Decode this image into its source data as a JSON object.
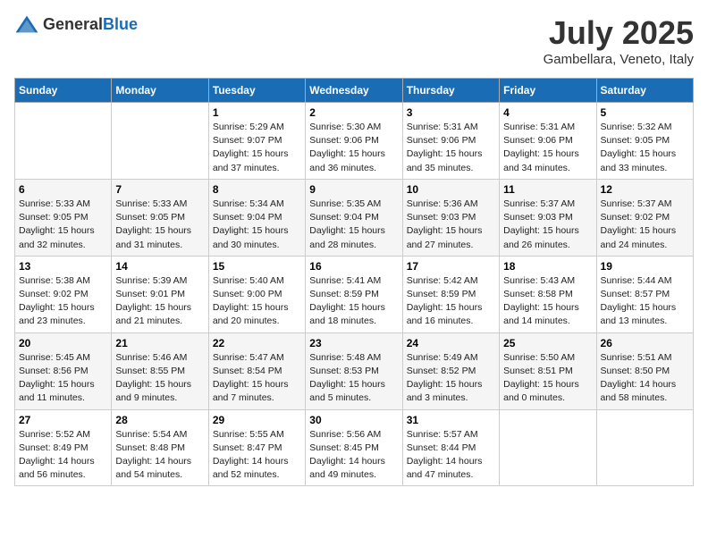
{
  "header": {
    "logo_general": "General",
    "logo_blue": "Blue",
    "month": "July 2025",
    "location": "Gambellara, Veneto, Italy"
  },
  "columns": [
    "Sunday",
    "Monday",
    "Tuesday",
    "Wednesday",
    "Thursday",
    "Friday",
    "Saturday"
  ],
  "weeks": [
    [
      {
        "day": "",
        "details": ""
      },
      {
        "day": "",
        "details": ""
      },
      {
        "day": "1",
        "details": "Sunrise: 5:29 AM\nSunset: 9:07 PM\nDaylight: 15 hours and 37 minutes."
      },
      {
        "day": "2",
        "details": "Sunrise: 5:30 AM\nSunset: 9:06 PM\nDaylight: 15 hours and 36 minutes."
      },
      {
        "day": "3",
        "details": "Sunrise: 5:31 AM\nSunset: 9:06 PM\nDaylight: 15 hours and 35 minutes."
      },
      {
        "day": "4",
        "details": "Sunrise: 5:31 AM\nSunset: 9:06 PM\nDaylight: 15 hours and 34 minutes."
      },
      {
        "day": "5",
        "details": "Sunrise: 5:32 AM\nSunset: 9:05 PM\nDaylight: 15 hours and 33 minutes."
      }
    ],
    [
      {
        "day": "6",
        "details": "Sunrise: 5:33 AM\nSunset: 9:05 PM\nDaylight: 15 hours and 32 minutes."
      },
      {
        "day": "7",
        "details": "Sunrise: 5:33 AM\nSunset: 9:05 PM\nDaylight: 15 hours and 31 minutes."
      },
      {
        "day": "8",
        "details": "Sunrise: 5:34 AM\nSunset: 9:04 PM\nDaylight: 15 hours and 30 minutes."
      },
      {
        "day": "9",
        "details": "Sunrise: 5:35 AM\nSunset: 9:04 PM\nDaylight: 15 hours and 28 minutes."
      },
      {
        "day": "10",
        "details": "Sunrise: 5:36 AM\nSunset: 9:03 PM\nDaylight: 15 hours and 27 minutes."
      },
      {
        "day": "11",
        "details": "Sunrise: 5:37 AM\nSunset: 9:03 PM\nDaylight: 15 hours and 26 minutes."
      },
      {
        "day": "12",
        "details": "Sunrise: 5:37 AM\nSunset: 9:02 PM\nDaylight: 15 hours and 24 minutes."
      }
    ],
    [
      {
        "day": "13",
        "details": "Sunrise: 5:38 AM\nSunset: 9:02 PM\nDaylight: 15 hours and 23 minutes."
      },
      {
        "day": "14",
        "details": "Sunrise: 5:39 AM\nSunset: 9:01 PM\nDaylight: 15 hours and 21 minutes."
      },
      {
        "day": "15",
        "details": "Sunrise: 5:40 AM\nSunset: 9:00 PM\nDaylight: 15 hours and 20 minutes."
      },
      {
        "day": "16",
        "details": "Sunrise: 5:41 AM\nSunset: 8:59 PM\nDaylight: 15 hours and 18 minutes."
      },
      {
        "day": "17",
        "details": "Sunrise: 5:42 AM\nSunset: 8:59 PM\nDaylight: 15 hours and 16 minutes."
      },
      {
        "day": "18",
        "details": "Sunrise: 5:43 AM\nSunset: 8:58 PM\nDaylight: 15 hours and 14 minutes."
      },
      {
        "day": "19",
        "details": "Sunrise: 5:44 AM\nSunset: 8:57 PM\nDaylight: 15 hours and 13 minutes."
      }
    ],
    [
      {
        "day": "20",
        "details": "Sunrise: 5:45 AM\nSunset: 8:56 PM\nDaylight: 15 hours and 11 minutes."
      },
      {
        "day": "21",
        "details": "Sunrise: 5:46 AM\nSunset: 8:55 PM\nDaylight: 15 hours and 9 minutes."
      },
      {
        "day": "22",
        "details": "Sunrise: 5:47 AM\nSunset: 8:54 PM\nDaylight: 15 hours and 7 minutes."
      },
      {
        "day": "23",
        "details": "Sunrise: 5:48 AM\nSunset: 8:53 PM\nDaylight: 15 hours and 5 minutes."
      },
      {
        "day": "24",
        "details": "Sunrise: 5:49 AM\nSunset: 8:52 PM\nDaylight: 15 hours and 3 minutes."
      },
      {
        "day": "25",
        "details": "Sunrise: 5:50 AM\nSunset: 8:51 PM\nDaylight: 15 hours and 0 minutes."
      },
      {
        "day": "26",
        "details": "Sunrise: 5:51 AM\nSunset: 8:50 PM\nDaylight: 14 hours and 58 minutes."
      }
    ],
    [
      {
        "day": "27",
        "details": "Sunrise: 5:52 AM\nSunset: 8:49 PM\nDaylight: 14 hours and 56 minutes."
      },
      {
        "day": "28",
        "details": "Sunrise: 5:54 AM\nSunset: 8:48 PM\nDaylight: 14 hours and 54 minutes."
      },
      {
        "day": "29",
        "details": "Sunrise: 5:55 AM\nSunset: 8:47 PM\nDaylight: 14 hours and 52 minutes."
      },
      {
        "day": "30",
        "details": "Sunrise: 5:56 AM\nSunset: 8:45 PM\nDaylight: 14 hours and 49 minutes."
      },
      {
        "day": "31",
        "details": "Sunrise: 5:57 AM\nSunset: 8:44 PM\nDaylight: 14 hours and 47 minutes."
      },
      {
        "day": "",
        "details": ""
      },
      {
        "day": "",
        "details": ""
      }
    ]
  ]
}
